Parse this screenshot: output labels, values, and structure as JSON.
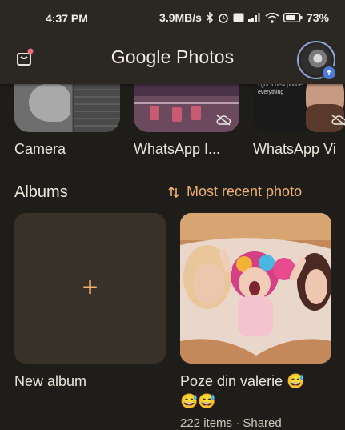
{
  "status_bar": {
    "time": "4:37 PM",
    "speed": "3.9MB/s",
    "battery": "73%"
  },
  "app_bar": {
    "title_google": "Google",
    "title_photos": "Photos"
  },
  "folders": [
    {
      "label": "Camera"
    },
    {
      "label": "WhatsApp I..."
    },
    {
      "label": "WhatsApp Vi"
    }
  ],
  "thumb_text": "I got a new phone everything",
  "albums_section": {
    "heading": "Albums",
    "sort_label": "Most recent photo"
  },
  "albums": [
    {
      "title": "New album"
    },
    {
      "title_line1": "Poze din valerie 😅",
      "title_line2": "😅😅",
      "subtitle": "222 items · Shared"
    }
  ],
  "colors": {
    "accent": "#f0b06e",
    "background": "#1f1d19",
    "bar": "#2b2823"
  }
}
